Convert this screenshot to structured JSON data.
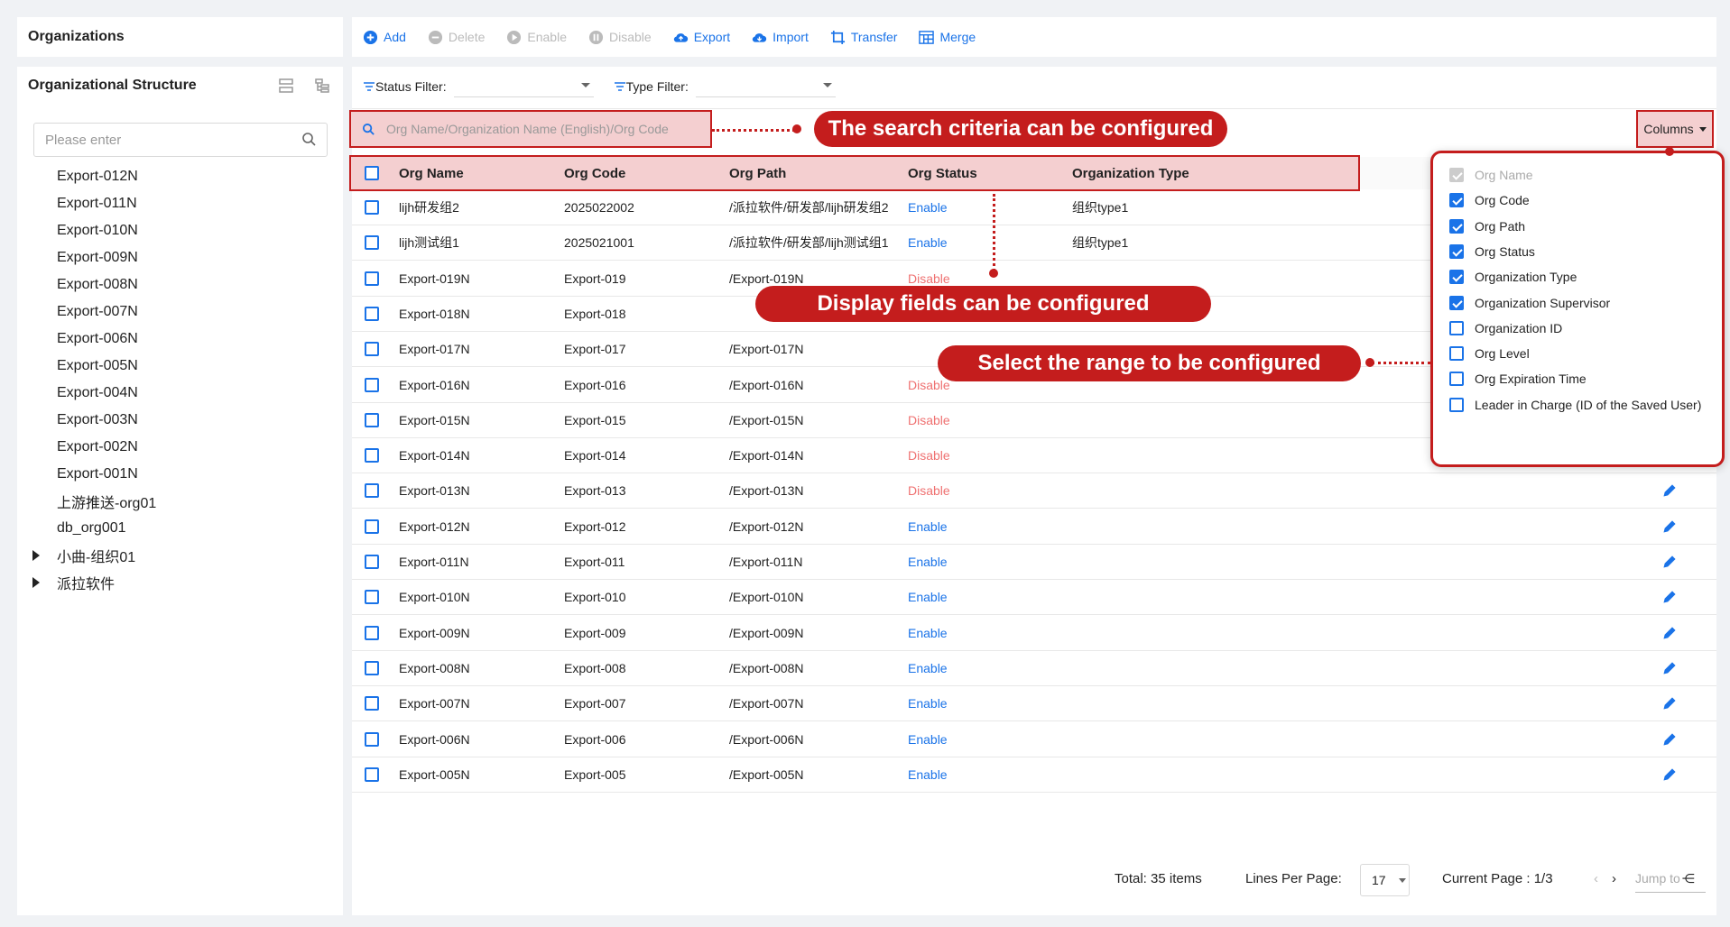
{
  "left_header": {
    "title": "Organizations"
  },
  "left_panel": {
    "title": "Organizational Structure",
    "search_placeholder": "Please enter",
    "tree": [
      {
        "label": "Export-012N",
        "expandable": false
      },
      {
        "label": "Export-011N",
        "expandable": false
      },
      {
        "label": "Export-010N",
        "expandable": false
      },
      {
        "label": "Export-009N",
        "expandable": false
      },
      {
        "label": "Export-008N",
        "expandable": false
      },
      {
        "label": "Export-007N",
        "expandable": false
      },
      {
        "label": "Export-006N",
        "expandable": false
      },
      {
        "label": "Export-005N",
        "expandable": false
      },
      {
        "label": "Export-004N",
        "expandable": false
      },
      {
        "label": "Export-003N",
        "expandable": false
      },
      {
        "label": "Export-002N",
        "expandable": false
      },
      {
        "label": "Export-001N",
        "expandable": false
      },
      {
        "label": "上游推送-org01",
        "expandable": false
      },
      {
        "label": "db_org001",
        "expandable": false
      },
      {
        "label": "小曲-组织01",
        "expandable": true
      },
      {
        "label": "派拉软件",
        "expandable": true
      }
    ]
  },
  "toolbar": {
    "add": "Add",
    "delete": "Delete",
    "enable": "Enable",
    "disable": "Disable",
    "export": "Export",
    "import": "Import",
    "transfer": "Transfer",
    "merge": "Merge"
  },
  "filters": {
    "status_label": "Status Filter:",
    "type_label": "Type Filter:"
  },
  "search": {
    "placeholder": "Org Name/Organization Name (English)/Org Code"
  },
  "columns_button": "Columns",
  "table": {
    "headers": [
      "Org Name",
      "Org Code",
      "Org Path",
      "Org Status",
      "Organization Type"
    ],
    "rows": [
      {
        "name": "lijh研发组2",
        "code": "2025022002",
        "path": "/派拉软件/研发部/lijh研发组2",
        "status": "Enable",
        "type": "组织type1",
        "edit": false
      },
      {
        "name": "lijh测试组1",
        "code": "2025021001",
        "path": "/派拉软件/研发部/lijh测试组1",
        "status": "Enable",
        "type": "组织type1",
        "edit": false
      },
      {
        "name": "Export-019N",
        "code": "Export-019",
        "path": "/Export-019N",
        "status": "Disable",
        "type": "",
        "edit": false
      },
      {
        "name": "Export-018N",
        "code": "Export-018",
        "path": "",
        "status": "",
        "type": "",
        "edit": false
      },
      {
        "name": "Export-017N",
        "code": "Export-017",
        "path": "/Export-017N",
        "status": "",
        "type": "",
        "edit": false
      },
      {
        "name": "Export-016N",
        "code": "Export-016",
        "path": "/Export-016N",
        "status": "Disable",
        "type": "",
        "edit": false
      },
      {
        "name": "Export-015N",
        "code": "Export-015",
        "path": "/Export-015N",
        "status": "Disable",
        "type": "",
        "edit": false
      },
      {
        "name": "Export-014N",
        "code": "Export-014",
        "path": "/Export-014N",
        "status": "Disable",
        "type": "",
        "edit": false
      },
      {
        "name": "Export-013N",
        "code": "Export-013",
        "path": "/Export-013N",
        "status": "Disable",
        "type": "",
        "edit": true
      },
      {
        "name": "Export-012N",
        "code": "Export-012",
        "path": "/Export-012N",
        "status": "Enable",
        "type": "",
        "edit": true
      },
      {
        "name": "Export-011N",
        "code": "Export-011",
        "path": "/Export-011N",
        "status": "Enable",
        "type": "",
        "edit": true
      },
      {
        "name": "Export-010N",
        "code": "Export-010",
        "path": "/Export-010N",
        "status": "Enable",
        "type": "",
        "edit": true
      },
      {
        "name": "Export-009N",
        "code": "Export-009",
        "path": "/Export-009N",
        "status": "Enable",
        "type": "",
        "edit": true
      },
      {
        "name": "Export-008N",
        "code": "Export-008",
        "path": "/Export-008N",
        "status": "Enable",
        "type": "",
        "edit": true
      },
      {
        "name": "Export-007N",
        "code": "Export-007",
        "path": "/Export-007N",
        "status": "Enable",
        "type": "",
        "edit": true
      },
      {
        "name": "Export-006N",
        "code": "Export-006",
        "path": "/Export-006N",
        "status": "Enable",
        "type": "",
        "edit": true
      },
      {
        "name": "Export-005N",
        "code": "Export-005",
        "path": "/Export-005N",
        "status": "Enable",
        "type": "",
        "edit": true
      }
    ]
  },
  "pagination": {
    "total": "Total: 35 items",
    "lines_label": "Lines Per Page:",
    "lines_value": "17",
    "current": "Current Page : 1/3",
    "jump": "Jump to"
  },
  "column_options": [
    {
      "label": "Org Name",
      "checked": true,
      "disabled": true
    },
    {
      "label": "Org Code",
      "checked": true,
      "disabled": false
    },
    {
      "label": "Org Path",
      "checked": true,
      "disabled": false
    },
    {
      "label": "Org Status",
      "checked": true,
      "disabled": false
    },
    {
      "label": "Organization Type",
      "checked": true,
      "disabled": false
    },
    {
      "label": "Organization Supervisor",
      "checked": true,
      "disabled": false
    },
    {
      "label": "Organization ID",
      "checked": false,
      "disabled": false
    },
    {
      "label": "Org Level",
      "checked": false,
      "disabled": false
    },
    {
      "label": "Org Expiration Time",
      "checked": false,
      "disabled": false
    },
    {
      "label": "Leader in Charge (ID of the Saved User)",
      "checked": false,
      "disabled": false
    }
  ],
  "annotations": {
    "search": "The search criteria can be configured",
    "display": "Display fields can be configured",
    "range": "Select the range to be configured"
  },
  "colors": {
    "accent": "#1a73e8",
    "annotation": "#c41d1d",
    "disabled_status": "#ef7171"
  }
}
